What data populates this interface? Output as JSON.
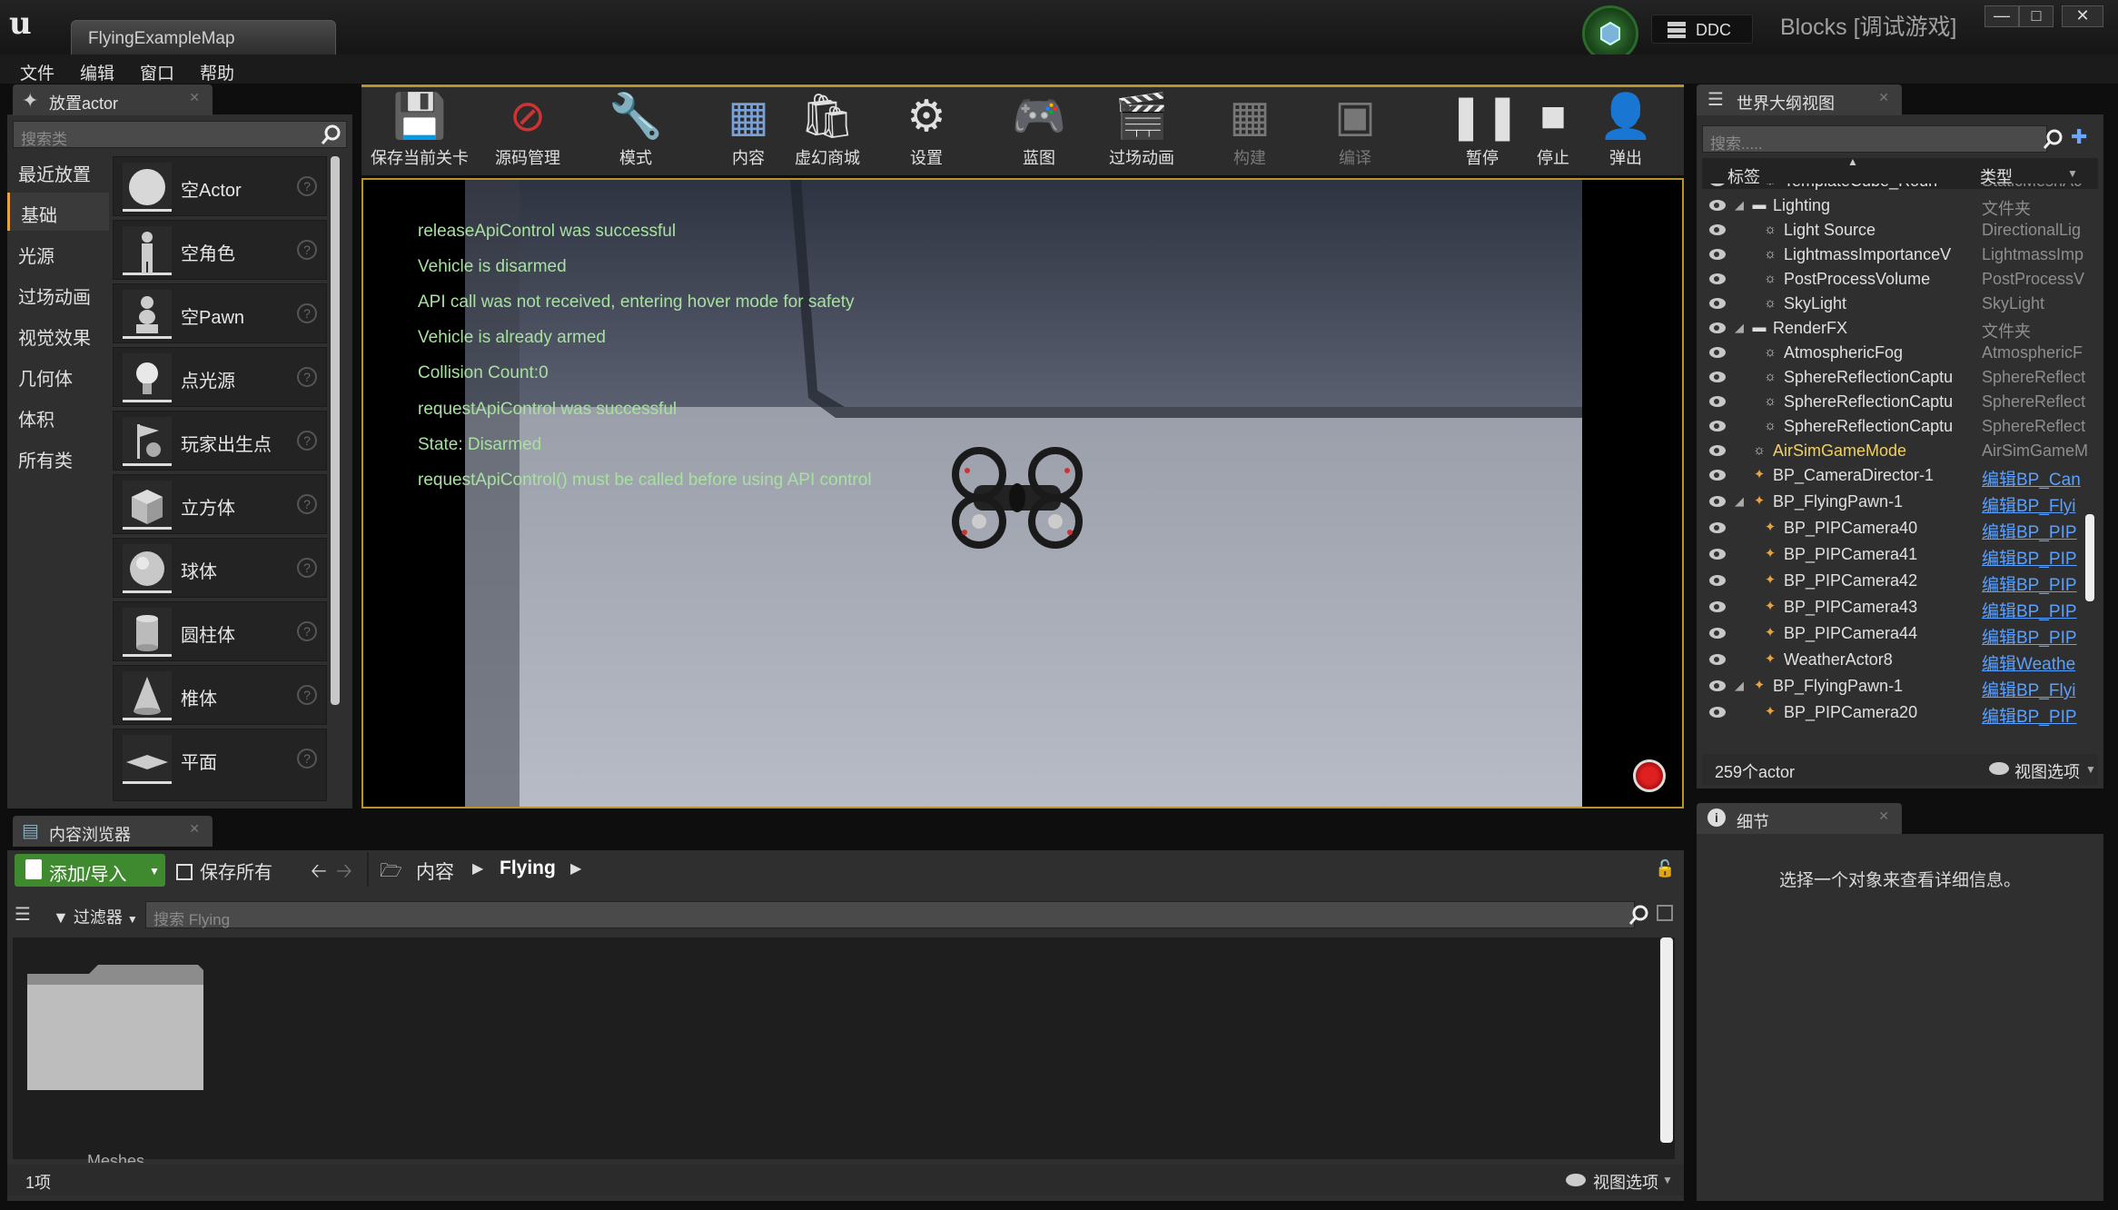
{
  "app": {
    "level_tab": "FlyingExampleMap",
    "title": "Blocks [调试游戏]",
    "ddc": "DDC"
  },
  "menu": [
    "文件",
    "编辑",
    "窗口",
    "帮助"
  ],
  "place_actor": {
    "tab": "放置actor",
    "search_placeholder": "搜索类",
    "categories": [
      "最近放置",
      "基础",
      "光源",
      "过场动画",
      "视觉效果",
      "几何体",
      "体积",
      "所有类"
    ],
    "selected_category": "基础",
    "items": [
      "空Actor",
      "空角色",
      "空Pawn",
      "点光源",
      "玩家出生点",
      "立方体",
      "球体",
      "圆柱体",
      "椎体",
      "平面"
    ]
  },
  "toolbar": [
    "保存当前关卡",
    "源码管理",
    "模式",
    "内容",
    "虚幻商城",
    "设置",
    "蓝图",
    "过场动画",
    "构建",
    "编译",
    "暂停",
    "停止",
    "弹出"
  ],
  "viewport": {
    "log": [
      "releaseApiControl was successful",
      "Vehicle is disarmed",
      "API call was not received, entering hover mode for safety",
      "Vehicle is already armed",
      "Collision Count:0",
      "requestApiControl was successful",
      "State: Disarmed",
      "requestApiControl() must be called before using API control"
    ]
  },
  "outliner": {
    "tab": "世界大纲视图",
    "search_placeholder": "搜索.....",
    "col_label": "标签",
    "col_type": "类型",
    "rows": [
      {
        "name": "TemplateCube_Roun",
        "type": "StaticMeshAc",
        "indent": 2,
        "link": false
      },
      {
        "name": "Lighting",
        "type": "文件夹",
        "indent": 1,
        "link": false,
        "folder": true
      },
      {
        "name": "Light Source",
        "type": "DirectionalLig",
        "indent": 2,
        "link": false
      },
      {
        "name": "LightmassImportanceV",
        "type": "LightmassImp",
        "indent": 2,
        "link": false
      },
      {
        "name": "PostProcessVolume",
        "type": "PostProcessV",
        "indent": 2,
        "link": false
      },
      {
        "name": "SkyLight",
        "type": "SkyLight",
        "indent": 2,
        "link": false
      },
      {
        "name": "RenderFX",
        "type": "文件夹",
        "indent": 1,
        "link": false,
        "folder": true
      },
      {
        "name": "AtmosphericFog",
        "type": "AtmosphericF",
        "indent": 2,
        "link": false
      },
      {
        "name": "SphereReflectionCaptu",
        "type": "SphereReflect",
        "indent": 2,
        "link": false
      },
      {
        "name": "SphereReflectionCaptu",
        "type": "SphereReflect",
        "indent": 2,
        "link": false
      },
      {
        "name": "SphereReflectionCaptu",
        "type": "SphereReflect",
        "indent": 2,
        "link": false
      },
      {
        "name": "AirSimGameMode",
        "type": "AirSimGameM",
        "indent": 1,
        "link": false,
        "yellow": true
      },
      {
        "name": "BP_CameraDirector-1",
        "type": "编辑BP_Can",
        "indent": 1,
        "link": true
      },
      {
        "name": "BP_FlyingPawn-1",
        "type": "编辑BP_Flyi",
        "indent": 1,
        "link": true,
        "expander": true
      },
      {
        "name": "BP_PIPCamera40",
        "type": "编辑BP_PIP",
        "indent": 2,
        "link": true
      },
      {
        "name": "BP_PIPCamera41",
        "type": "编辑BP_PIP",
        "indent": 2,
        "link": true
      },
      {
        "name": "BP_PIPCamera42",
        "type": "编辑BP_PIP",
        "indent": 2,
        "link": true
      },
      {
        "name": "BP_PIPCamera43",
        "type": "编辑BP_PIP",
        "indent": 2,
        "link": true
      },
      {
        "name": "BP_PIPCamera44",
        "type": "编辑BP_PIP",
        "indent": 2,
        "link": true
      },
      {
        "name": "WeatherActor8",
        "type": "编辑Weathe",
        "indent": 2,
        "link": true
      },
      {
        "name": "BP_FlyingPawn-1",
        "type": "编辑BP_Flyi",
        "indent": 1,
        "link": true,
        "expander": true
      },
      {
        "name": "BP_PIPCamera20",
        "type": "编辑BP_PIP",
        "indent": 2,
        "link": true
      }
    ],
    "count": "259个actor",
    "view_options": "视图选项"
  },
  "details": {
    "tab": "细节",
    "empty_msg": "选择一个对象来查看详细信息。"
  },
  "content_browser": {
    "tab": "内容浏览器",
    "add_import": "添加/导入",
    "save_all": "保存所有",
    "path_root": "内容",
    "path_current": "Flying",
    "filter": "过滤器",
    "search_placeholder": "搜索 Flying",
    "folder_label": "Meshes",
    "count": "1项",
    "view_options": "视图选项"
  },
  "colors": {
    "accent": "#e8a33d",
    "add_button": "#3f8a2f",
    "log_text": "#a8e0a0",
    "link": "#5aa0ff",
    "folder_name": "#f0d060"
  }
}
